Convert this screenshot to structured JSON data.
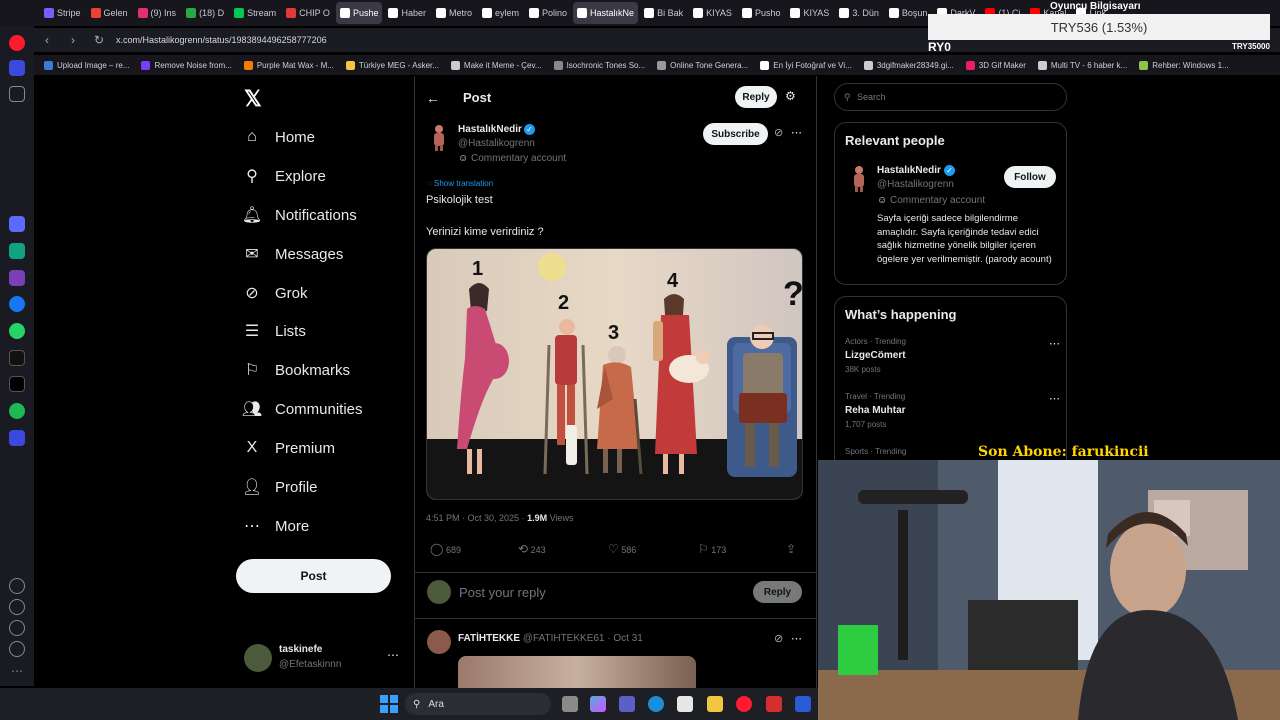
{
  "browser": {
    "tabs": [
      {
        "label": "Stripe",
        "color": "#7a5cff"
      },
      {
        "label": "Gelen",
        "color": "#ea4335"
      },
      {
        "label": "(9) Ins",
        "color": "#e1306c"
      },
      {
        "label": "(18) D",
        "color": "#28a745"
      },
      {
        "label": "Stream",
        "color": "#00c853"
      },
      {
        "label": "CHIP O",
        "color": "#e53935"
      },
      {
        "label": "Pushe",
        "color": "#ffffff",
        "active": true
      },
      {
        "label": "Haber",
        "color": "#ffffff"
      },
      {
        "label": "Metro",
        "color": "#ffffff"
      },
      {
        "label": "eylem",
        "color": "#ffffff"
      },
      {
        "label": "Polino",
        "color": "#ffffff"
      },
      {
        "label": "HastalıkNe",
        "color": "#ffffff",
        "active": true
      },
      {
        "label": "Bi Bak",
        "color": "#ffffff"
      },
      {
        "label": "KIYAS",
        "color": "#ffffff"
      },
      {
        "label": "Pusho",
        "color": "#ffffff"
      },
      {
        "label": "KIYAS",
        "color": "#ffffff"
      },
      {
        "label": "3. Dün",
        "color": "#ffffff"
      },
      {
        "label": "Boşun",
        "color": "#ffffff"
      },
      {
        "label": "DarkV",
        "color": "#ffffff"
      },
      {
        "label": "(1) Ci",
        "color": "#ff0000"
      },
      {
        "label": "Kanal",
        "color": "#ff0000"
      },
      {
        "label": "Link",
        "color": "#ffffff"
      }
    ],
    "url": "x.com/Hastalikogrenn/status/1983894496258777206",
    "bookmarks": [
      {
        "label": "Upload Image – re...",
        "color": "#3a7bd5"
      },
      {
        "label": "Remove Noise from...",
        "color": "#7a3cff"
      },
      {
        "label": "Purple Mat Wax - M...",
        "color": "#f57c00"
      },
      {
        "label": "Türkiye MEG - Asker...",
        "color": "#f4c542"
      },
      {
        "label": "Make it Meme - Çev...",
        "color": "#cccccc"
      },
      {
        "label": "Isochronic Tones So...",
        "color": "#888888"
      },
      {
        "label": "Online Tone Genera...",
        "color": "#999999"
      },
      {
        "label": "En İyi Fotoğraf ve Vi...",
        "color": "#ffffff"
      },
      {
        "label": "3dgifmaker28349.gi...",
        "color": "#cccccc"
      },
      {
        "label": "3D Gif Maker",
        "color": "#e91e63"
      },
      {
        "label": "Multi TV - 6 haber k...",
        "color": "#cccccc"
      },
      {
        "label": "Rehber: Windows 1...",
        "color": "#8bc34a"
      }
    ]
  },
  "nav": {
    "items": [
      {
        "label": "Home",
        "icon": "home-icon",
        "glyph": "⌂"
      },
      {
        "label": "Explore",
        "icon": "search-icon",
        "glyph": "⚲"
      },
      {
        "label": "Notifications",
        "icon": "bell-icon",
        "glyph": "🔔︎"
      },
      {
        "label": "Messages",
        "icon": "mail-icon",
        "glyph": "✉"
      },
      {
        "label": "Grok",
        "icon": "grok-icon",
        "glyph": "⊘"
      },
      {
        "label": "Lists",
        "icon": "list-icon",
        "glyph": "☰"
      },
      {
        "label": "Bookmarks",
        "icon": "bookmark-icon",
        "glyph": "⚐"
      },
      {
        "label": "Communities",
        "icon": "people-icon",
        "glyph": "👥︎"
      },
      {
        "label": "Premium",
        "icon": "x-logo-icon",
        "glyph": "X"
      },
      {
        "label": "Profile",
        "icon": "person-icon",
        "glyph": "👤︎"
      },
      {
        "label": "More",
        "icon": "more-circle-icon",
        "glyph": "⋯"
      }
    ],
    "post_label": "Post",
    "account": {
      "name": "taskinefe",
      "handle": "@Efetaskinnn"
    }
  },
  "header": {
    "title": "Post",
    "reply_label": "Reply"
  },
  "post": {
    "author": "HastalıkNedir",
    "handle": "@Hastalikogrenn",
    "account_label": "Commentary account",
    "subscribe_label": "Subscribe",
    "show_translation": "Show translation",
    "text_line1": "Psikolojik test",
    "text_line2": "Yerinizi kime verirdiniz ?",
    "image_numbers": [
      "1",
      "2",
      "3",
      "4"
    ],
    "time": "4:51 PM · Oct 30, 2025 · ",
    "views": "1.9M",
    "views_label": "Views",
    "stats": {
      "replies": "689",
      "reposts": "243",
      "likes": "586",
      "bookmarks": "173"
    },
    "reply_placeholder": "Post your reply",
    "reply_button": "Reply"
  },
  "reply_preview": {
    "author": "FATİHTEKKE",
    "handle": "@FATIHTEKKE61",
    "date": "· Oct 31"
  },
  "sidebar": {
    "search_placeholder": "Search",
    "relevant": {
      "title": "Relevant people",
      "name": "HastalıkNedir",
      "handle": "@Hastalikogrenn",
      "account_label": "Commentary account",
      "follow_label": "Follow",
      "bio": "Sayfa içeriği sadece bilgilendirme amaçlıdır. Sayfa içeriğinde tedavi edici sağlık hizmetine yönelik bilgiler içeren ögelere yer verilmemiştir. (parody acount)"
    },
    "happening": {
      "title": "What’s happening",
      "trends": [
        {
          "context": "Actors · Trending",
          "name": "LizgeCömert",
          "count": "38K posts"
        },
        {
          "context": "Travel · Trending",
          "name": "Reha Muhtar",
          "count": "1,707 posts"
        },
        {
          "context": "Sports · Trending",
          "name": "",
          "count": ""
        }
      ]
    }
  },
  "overlay": {
    "ticker": "TRY536 (1.53%)",
    "stream_title": "Oyuncu Bilgisayarı",
    "left_code": "RY0",
    "right_code": "TRY35000",
    "subscriber": "Son Abone: farukincii"
  },
  "taskbar": {
    "search_placeholder": "Ara"
  }
}
